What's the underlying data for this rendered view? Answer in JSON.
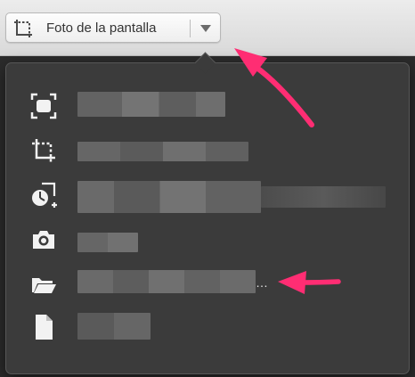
{
  "toolbar": {
    "screenshot_label": "Foto de la pantalla"
  },
  "menu": {
    "items": [
      {
        "icon": "fullscreen-capture-icon",
        "label": ""
      },
      {
        "icon": "selection-capture-icon",
        "label": ""
      },
      {
        "icon": "timed-capture-icon",
        "label": ""
      },
      {
        "icon": "camera-icon",
        "label": ""
      },
      {
        "icon": "folder-icon",
        "label": "…"
      },
      {
        "icon": "document-icon",
        "label": ""
      }
    ]
  },
  "colors": {
    "annotation_arrow": "#ff2d73",
    "menu_background": "#3b3b3b",
    "icon": "#f2f2f2"
  }
}
